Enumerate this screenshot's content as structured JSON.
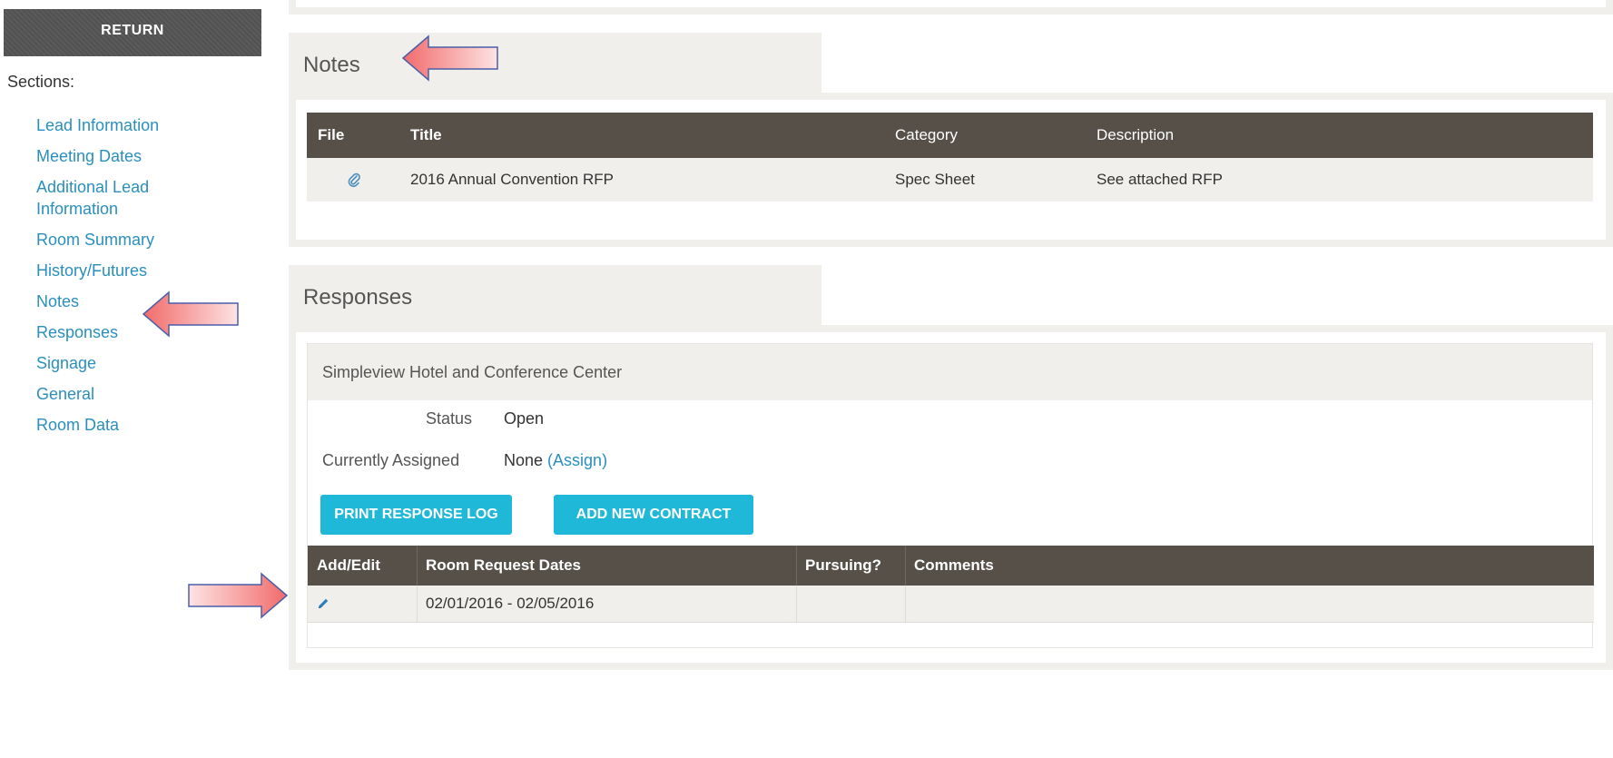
{
  "sidebar": {
    "return_label": "RETURN",
    "sections_label": "Sections:",
    "items": [
      {
        "label": "Lead Information"
      },
      {
        "label": "Meeting Dates"
      },
      {
        "label": "Additional Lead Information"
      },
      {
        "label": "Room Summary"
      },
      {
        "label": "History/Futures"
      },
      {
        "label": "Notes"
      },
      {
        "label": "Responses"
      },
      {
        "label": "Signage"
      },
      {
        "label": "General"
      },
      {
        "label": "Room Data"
      }
    ]
  },
  "notes": {
    "title": "Notes",
    "columns": [
      "File",
      "Title",
      "Category",
      "Description"
    ],
    "rows": [
      {
        "title": "2016 Annual Convention RFP",
        "category": "Spec Sheet",
        "description": "See attached RFP"
      }
    ]
  },
  "responses": {
    "title": "Responses",
    "hotel_name": "Simpleview Hotel and Conference Center",
    "status_label": "Status",
    "status_value": "Open",
    "assigned_label": "Currently Assigned",
    "assigned_value": "None",
    "assign_link": "(Assign)",
    "print_button": "PRINT RESPONSE LOG",
    "add_contract_button": "ADD NEW CONTRACT",
    "columns": [
      "Add/Edit",
      "Room Request Dates",
      "Pursuing?",
      "Comments"
    ],
    "rows": [
      {
        "dates": "02/01/2016 - 02/05/2016",
        "pursuing": "",
        "comments": ""
      }
    ]
  },
  "colors": {
    "link": "#2a8fbd",
    "header_dark": "#565049",
    "button_cyan": "#1fb8d9",
    "arrow_red": "#f26b6b"
  },
  "icons": {
    "file": "paperclip-icon",
    "edit": "pencil-icon"
  }
}
